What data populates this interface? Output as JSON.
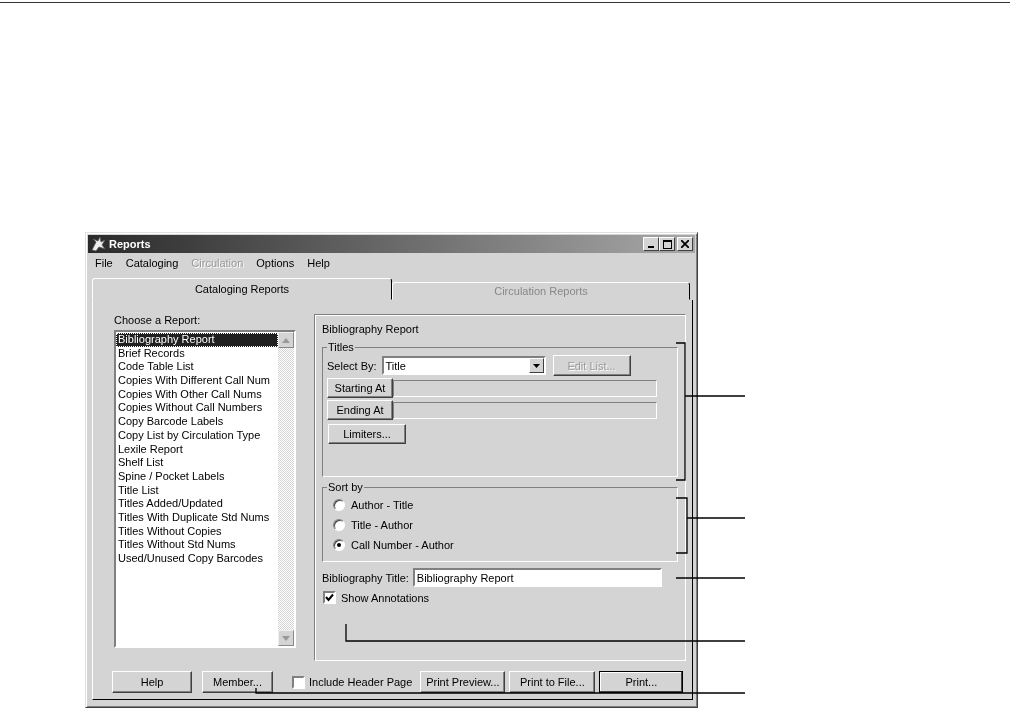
{
  "window": {
    "title": "Reports"
  },
  "menu": [
    {
      "label": "File",
      "disabled": false
    },
    {
      "label": "Cataloging",
      "disabled": false
    },
    {
      "label": "Circulation",
      "disabled": true
    },
    {
      "label": "Options",
      "disabled": false
    },
    {
      "label": "Help",
      "disabled": false
    }
  ],
  "tabs": [
    {
      "label": "Cataloging Reports",
      "selected": true
    },
    {
      "label": "Circulation Reports",
      "selected": false
    }
  ],
  "report_list": {
    "label": "Choose a Report:",
    "items": [
      {
        "label": "Bibliography Report",
        "selected": true
      },
      {
        "label": "Brief Records",
        "selected": false
      },
      {
        "label": "Code Table List",
        "selected": false
      },
      {
        "label": "Copies With Different Call Num",
        "selected": false
      },
      {
        "label": "Copies With Other Call Nums",
        "selected": false
      },
      {
        "label": "Copies Without Call Numbers",
        "selected": false
      },
      {
        "label": "Copy Barcode Labels",
        "selected": false
      },
      {
        "label": "Copy List by Circulation Type",
        "selected": false
      },
      {
        "label": "Lexile Report",
        "selected": false
      },
      {
        "label": "Shelf List",
        "selected": false
      },
      {
        "label": "Spine / Pocket Labels",
        "selected": false
      },
      {
        "label": "Title List",
        "selected": false
      },
      {
        "label": "Titles Added/Updated",
        "selected": false
      },
      {
        "label": "Titles With Duplicate Std Nums",
        "selected": false
      },
      {
        "label": "Titles Without Copies",
        "selected": false
      },
      {
        "label": "Titles Without Std Nums",
        "selected": false
      },
      {
        "label": "Used/Unused Copy Barcodes",
        "selected": false
      }
    ]
  },
  "panel": {
    "title": "Bibliography Report",
    "titles_group": {
      "legend": "Titles",
      "select_by_label": "Select By:",
      "select_by_value": "Title",
      "edit_list_button": {
        "label": "Edit List...",
        "disabled": true
      },
      "starting_at_button": "Starting At",
      "ending_at_button": "Ending At",
      "limiters_button": "Limiters..."
    },
    "sort_group": {
      "legend": "Sort by",
      "options": [
        {
          "label": "Author - Title",
          "selected": false
        },
        {
          "label": "Title - Author",
          "selected": false
        },
        {
          "label": "Call Number - Author",
          "selected": true
        }
      ]
    },
    "bibliography_title": {
      "label": "Bibliography Title:",
      "value": "Bibliography Report"
    },
    "show_annotations": {
      "label": "Show Annotations",
      "checked": true
    }
  },
  "footer": {
    "help_button": "Help",
    "member_button": "Member...",
    "include_header_page": {
      "label": "Include Header Page",
      "checked": false
    },
    "buttons": [
      {
        "label": "Print Preview...",
        "default": false
      },
      {
        "label": "Print to File...",
        "default": false
      },
      {
        "label": "Print...",
        "default": true
      }
    ]
  }
}
